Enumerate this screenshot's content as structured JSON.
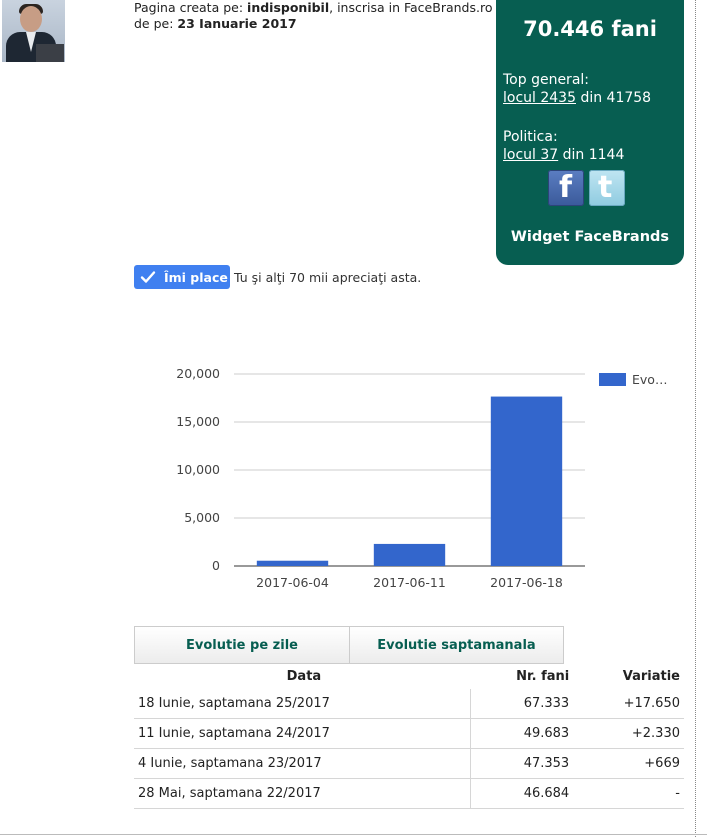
{
  "meta": {
    "created_prefix": "Pagina creata pe: ",
    "created_by": "indisponibil",
    "created_suffix": ", inscrisa in FaceBrands.ro",
    "date_prefix": "de pe: ",
    "date": "23 Ianuarie 2017"
  },
  "widget": {
    "fans": "70.446 fani",
    "top_general_label": "Top general:",
    "top_general_rank": "locul 2435",
    "top_general_total": " din 41758",
    "category_label": "Politica:",
    "category_rank": "locul 37",
    "category_total": " din 1144",
    "title": "Widget FaceBrands",
    "facebook_icon": "facebook-icon",
    "twitter_icon": "twitter-icon",
    "bg_color": "#075e51"
  },
  "like": {
    "button_label": "Îmi place",
    "text": "Tu şi alţi 70 mii apreciaţi asta."
  },
  "chart_data": {
    "type": "bar",
    "categories": [
      "2017-06-04",
      "2017-06-11",
      "2017-06-18"
    ],
    "series": [
      {
        "name": "Evo…",
        "values": [
          550,
          2300,
          17650
        ],
        "color": "#3366cc"
      }
    ],
    "yticks": [
      "0",
      "5,000",
      "10,000",
      "15,000",
      "20,000"
    ],
    "ylim": [
      0,
      20000
    ],
    "grid": true,
    "legend": "right"
  },
  "tabs": [
    "Evolutie pe zile",
    "Evolutie saptamanala"
  ],
  "table": {
    "headers": [
      "Data",
      "Nr. fani",
      "Variatie"
    ],
    "rows": [
      [
        "18 Iunie, saptamana 25/2017",
        "67.333",
        "+17.650"
      ],
      [
        "11 Iunie, saptamana 24/2017",
        "49.683",
        "+2.330"
      ],
      [
        "4 Iunie, saptamana 23/2017",
        "47.353",
        "+669"
      ],
      [
        "28 Mai, saptamana 22/2017",
        "46.684",
        "-"
      ]
    ]
  }
}
